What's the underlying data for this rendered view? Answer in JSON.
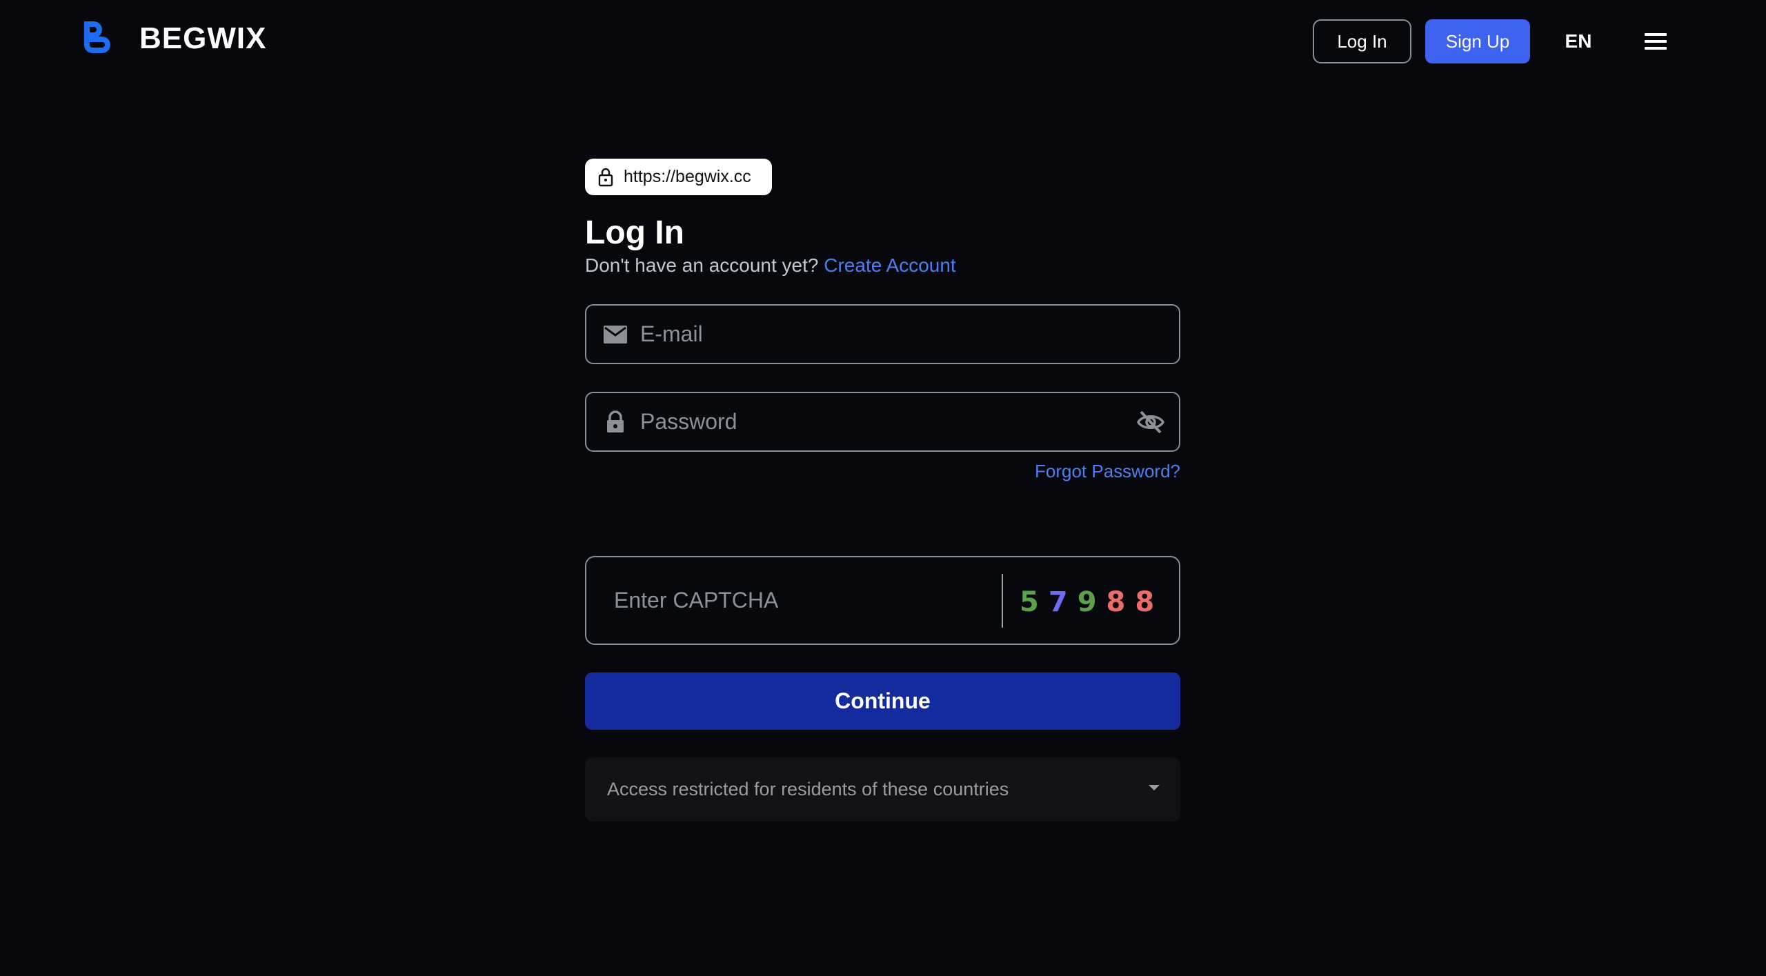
{
  "header": {
    "brand": "BEGWIX",
    "login_label": "Log In",
    "signup_label": "Sign Up",
    "language": "EN",
    "brand_color": "#1e6cf2",
    "signup_color": "#3d63f0"
  },
  "form": {
    "url": "https://begwix.cc",
    "title": "Log In",
    "prompt": "Don't have an account yet?",
    "create_account": "Create Account",
    "email_placeholder": "E-mail",
    "password_placeholder": "Password",
    "forgot_password": "Forgot Password?",
    "captcha_placeholder": "Enter CAPTCHA",
    "captcha_digits": [
      {
        "char": "5",
        "color": "#5aa14a"
      },
      {
        "char": "7",
        "color": "#6b6cf2"
      },
      {
        "char": "9",
        "color": "#5aa14a"
      },
      {
        "char": "8",
        "color": "#ee6b6b"
      },
      {
        "char": "8",
        "color": "#ee6b6b"
      }
    ],
    "continue_label": "Continue",
    "restricted_label": "Access restricted for residents of these countries"
  },
  "icons": {
    "email": "mail-icon",
    "password": "lock-icon",
    "visibility": "eye-off-icon",
    "url_lock": "lock-outline-icon",
    "menu": "hamburger-menu-icon",
    "dropdown": "caret-down-icon"
  }
}
